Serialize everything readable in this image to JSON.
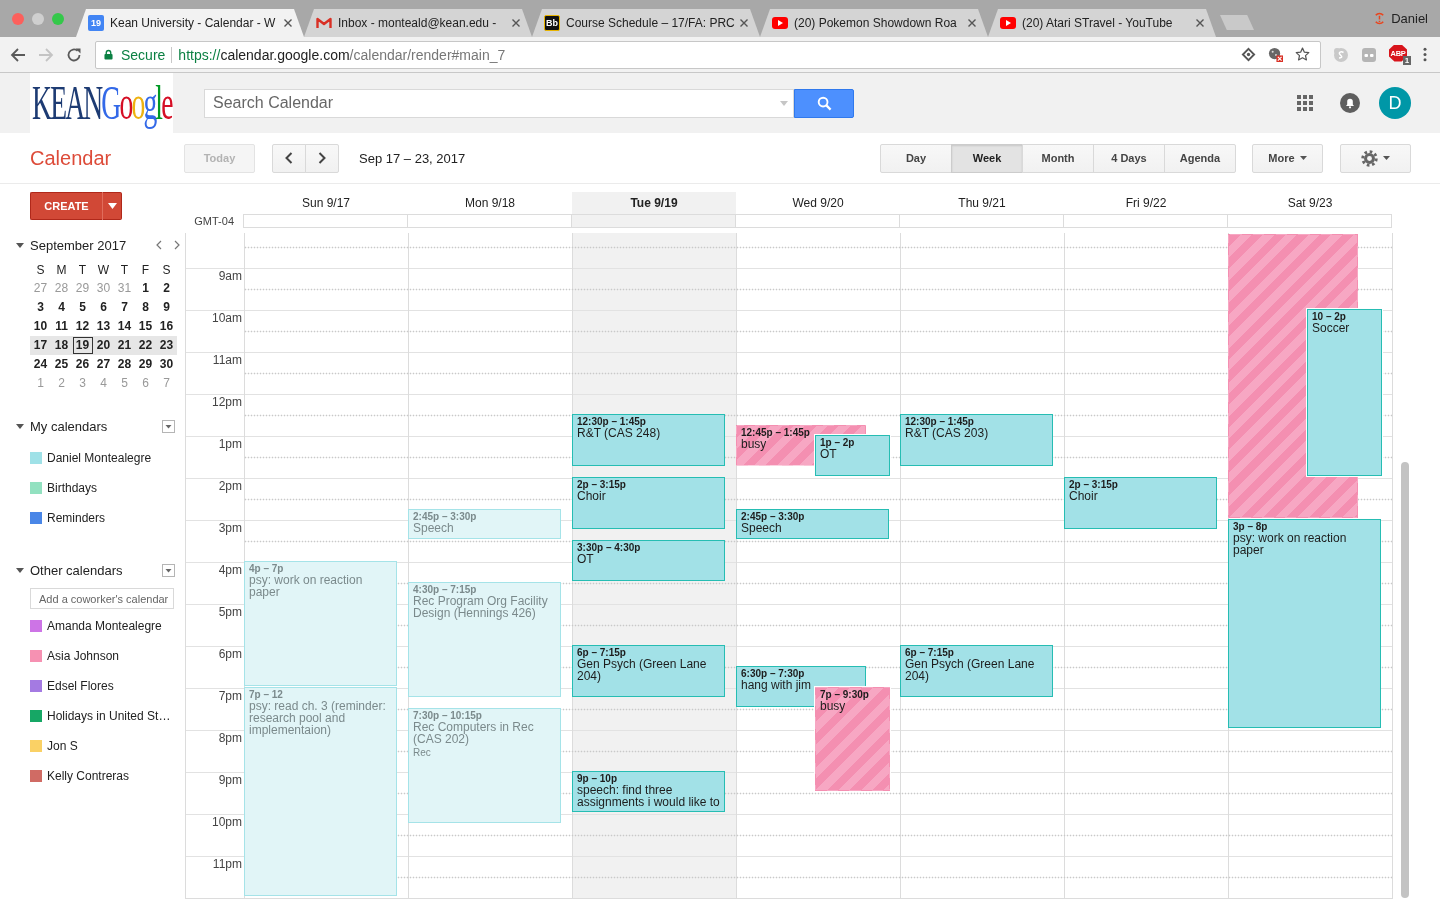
{
  "browser": {
    "tabs": [
      {
        "kind": "calendar",
        "icon_text": "19",
        "title": "Kean University - Calendar - W",
        "selected": true
      },
      {
        "kind": "mail",
        "title": "Inbox - monteald@kean.edu -",
        "selected": false
      },
      {
        "kind": "blackboard",
        "icon_text": "Bb",
        "title": "Course Schedule – 17/FA: PRC",
        "selected": false
      },
      {
        "kind": "video",
        "title": "(20) Pokemon Showdown Roa",
        "selected": false
      },
      {
        "kind": "video",
        "title": "(20) Atari STravel - YouTube",
        "selected": false
      }
    ],
    "profile": "Daniel",
    "address": {
      "security": "Secure",
      "scheme": "https://",
      "host": "calendar.google.com",
      "path": "/calendar/render#main_7"
    },
    "extensions": [
      {
        "kind": "bubble"
      },
      {
        "kind": "mask"
      },
      {
        "kind": "stop",
        "label": "ABP",
        "badge": "1"
      }
    ]
  },
  "header": {
    "logo": {
      "prefix": "KEAN",
      "name": "Google"
    },
    "search": {
      "placeholder": "Search Calendar"
    },
    "avatar": "D"
  },
  "toolbar": {
    "title": "Calendar",
    "today": {
      "label": "Today",
      "disabled": true
    },
    "date_range": "Sep 17 – 23, 2017",
    "views": [
      {
        "label": "Day",
        "selected": false
      },
      {
        "label": "Week",
        "selected": true
      },
      {
        "label": "Month",
        "selected": false
      },
      {
        "label": "4 Days",
        "selected": false
      },
      {
        "label": "Agenda",
        "selected": false
      }
    ],
    "more": "More"
  },
  "sidebar": {
    "create": "CREATE",
    "mini_calendar": {
      "month": "September 2017",
      "expanded": true,
      "weekdays": [
        "S",
        "M",
        "T",
        "W",
        "T",
        "F",
        "S"
      ],
      "weeks": [
        {
          "selected": false,
          "days": [
            {
              "text": "27",
              "other_month": true,
              "today": false
            },
            {
              "text": "28",
              "other_month": true,
              "today": false
            },
            {
              "text": "29",
              "other_month": true,
              "today": false
            },
            {
              "text": "30",
              "other_month": true,
              "today": false
            },
            {
              "text": "31",
              "other_month": true,
              "today": false
            },
            {
              "text": "1",
              "other_month": false,
              "today": false
            },
            {
              "text": "2",
              "other_month": false,
              "today": false
            }
          ]
        },
        {
          "selected": false,
          "days": [
            {
              "text": "3",
              "other_month": false,
              "today": false
            },
            {
              "text": "4",
              "other_month": false,
              "today": false
            },
            {
              "text": "5",
              "other_month": false,
              "today": false
            },
            {
              "text": "6",
              "other_month": false,
              "today": false
            },
            {
              "text": "7",
              "other_month": false,
              "today": false
            },
            {
              "text": "8",
              "other_month": false,
              "today": false
            },
            {
              "text": "9",
              "other_month": false,
              "today": false
            }
          ]
        },
        {
          "selected": false,
          "days": [
            {
              "text": "10",
              "other_month": false,
              "today": false
            },
            {
              "text": "11",
              "other_month": false,
              "today": false
            },
            {
              "text": "12",
              "other_month": false,
              "today": false
            },
            {
              "text": "13",
              "other_month": false,
              "today": false
            },
            {
              "text": "14",
              "other_month": false,
              "today": false
            },
            {
              "text": "15",
              "other_month": false,
              "today": false
            },
            {
              "text": "16",
              "other_month": false,
              "today": false
            }
          ]
        },
        {
          "selected": true,
          "days": [
            {
              "text": "17",
              "other_month": false,
              "today": false
            },
            {
              "text": "18",
              "other_month": false,
              "today": false
            },
            {
              "text": "19",
              "other_month": false,
              "today": true
            },
            {
              "text": "20",
              "other_month": false,
              "today": false
            },
            {
              "text": "21",
              "other_month": false,
              "today": false
            },
            {
              "text": "22",
              "other_month": false,
              "today": false
            },
            {
              "text": "23",
              "other_month": false,
              "today": false
            }
          ]
        },
        {
          "selected": false,
          "days": [
            {
              "text": "24",
              "other_month": false,
              "today": false
            },
            {
              "text": "25",
              "other_month": false,
              "today": false
            },
            {
              "text": "26",
              "other_month": false,
              "today": false
            },
            {
              "text": "27",
              "other_month": false,
              "today": false
            },
            {
              "text": "28",
              "other_month": false,
              "today": false
            },
            {
              "text": "29",
              "other_month": false,
              "today": false
            },
            {
              "text": "30",
              "other_month": false,
              "today": false
            }
          ]
        },
        {
          "selected": false,
          "days": [
            {
              "text": "1",
              "other_month": true,
              "today": false
            },
            {
              "text": "2",
              "other_month": true,
              "today": false
            },
            {
              "text": "3",
              "other_month": true,
              "today": false
            },
            {
              "text": "4",
              "other_month": true,
              "today": false
            },
            {
              "text": "5",
              "other_month": true,
              "today": false
            },
            {
              "text": "6",
              "other_month": true,
              "today": false
            },
            {
              "text": "7",
              "other_month": true,
              "today": false
            }
          ]
        }
      ]
    },
    "sections": [
      {
        "title": "My calendars",
        "expanded": true,
        "items": [
          {
            "name": "Daniel Montealegre",
            "color": "#9fe1e7"
          },
          {
            "name": "Birthdays",
            "color": "#92e1c0"
          },
          {
            "name": "Reminders",
            "color": "#4986e7"
          }
        ]
      },
      {
        "title": "Other calendars",
        "expanded": true,
        "add_placeholder": "Add a coworker's calendar",
        "items": [
          {
            "name": "Amanda Montealegre",
            "color": "#cd74e6"
          },
          {
            "name": "Asia Johnson",
            "color": "#f691b2"
          },
          {
            "name": "Edsel Flores",
            "color": "#a47ae2"
          },
          {
            "name": "Holidays in United St…",
            "color": "#16a765"
          },
          {
            "name": "Jon S",
            "color": "#fad165"
          },
          {
            "name": "Kelly Contreras",
            "color": "#d06b64"
          }
        ]
      }
    ]
  },
  "calendar": {
    "timezone": "GMT-04",
    "hours": [
      "9am",
      "10am",
      "11am",
      "12pm",
      "1pm",
      "2pm",
      "3pm",
      "4pm",
      "5pm",
      "6pm",
      "7pm",
      "8pm",
      "9pm",
      "10pm",
      "11pm"
    ],
    "days": [
      {
        "label": "Sun 9/17",
        "selected": false,
        "events": [
          {
            "kind": "event",
            "time": "4p – 7p",
            "title": "psy: work on reaction paper",
            "past": true
          },
          {
            "kind": "event",
            "time": "7p – 12",
            "title": "psy: read ch. 3 (reminder: research pool and implementaion)",
            "past": true
          }
        ]
      },
      {
        "label": "Mon 9/18",
        "selected": false,
        "events": [
          {
            "kind": "event",
            "time": "2:45p – 3:30p",
            "title": "Speech",
            "past": true
          },
          {
            "kind": "event",
            "time": "4:30p – 7:15p",
            "title": "Rec Program Org Facility Design (Hennings 426)",
            "past": true
          },
          {
            "kind": "event",
            "time": "7:30p – 10:15p",
            "title": "Rec Computers in Rec (CAS 202)",
            "detail": "Rec",
            "past": true
          }
        ]
      },
      {
        "label": "Tue 9/19",
        "selected": true,
        "events": [
          {
            "kind": "event",
            "time": "12:30p – 1:45p",
            "title": "R&T (CAS 248)",
            "past": false
          },
          {
            "kind": "event",
            "time": "2p – 3:15p",
            "title": "Choir",
            "past": false
          },
          {
            "kind": "event",
            "time": "3:30p – 4:30p",
            "title": "OT",
            "past": false
          },
          {
            "kind": "event",
            "time": "6p – 7:15p",
            "title": "Gen Psych (Green Lane 204)",
            "past": false
          },
          {
            "kind": "event",
            "time": "9p – 10p",
            "title": "speech: find three assignments i would like to",
            "past": false
          }
        ]
      },
      {
        "label": "Wed 9/20",
        "selected": false,
        "events": [
          {
            "kind": "busy",
            "time": "12:45p – 1:45p",
            "title": "busy",
            "past": false
          },
          {
            "kind": "event",
            "time": "1p – 2p",
            "title": "OT",
            "past": false
          },
          {
            "kind": "event",
            "time": "2:45p – 3:30p",
            "title": "Speech",
            "past": false
          },
          {
            "kind": "event",
            "time": "6:30p – 7:30p",
            "title": "hang with jim",
            "past": false
          },
          {
            "kind": "busy",
            "time": "7p – 9:30p",
            "title": "busy",
            "past": false
          }
        ]
      },
      {
        "label": "Thu 9/21",
        "selected": false,
        "events": [
          {
            "kind": "event",
            "time": "12:30p – 1:45p",
            "title": "R&T (CAS 203)",
            "past": false
          },
          {
            "kind": "event",
            "time": "6p – 7:15p",
            "title": "Gen Psych (Green Lane 204)",
            "past": false
          }
        ]
      },
      {
        "label": "Fri 9/22",
        "selected": false,
        "events": [
          {
            "kind": "event",
            "time": "2p – 3:15p",
            "title": "Choir",
            "past": false
          }
        ]
      },
      {
        "label": "Sat 9/23",
        "selected": false,
        "events": [
          {
            "kind": "busy",
            "past": false
          },
          {
            "kind": "event",
            "time": "10 – 2p",
            "title": "Soccer",
            "past": false
          },
          {
            "kind": "event",
            "time": "3p – 8p",
            "title": "psy: work on reaction paper",
            "past": false
          }
        ]
      }
    ]
  }
}
